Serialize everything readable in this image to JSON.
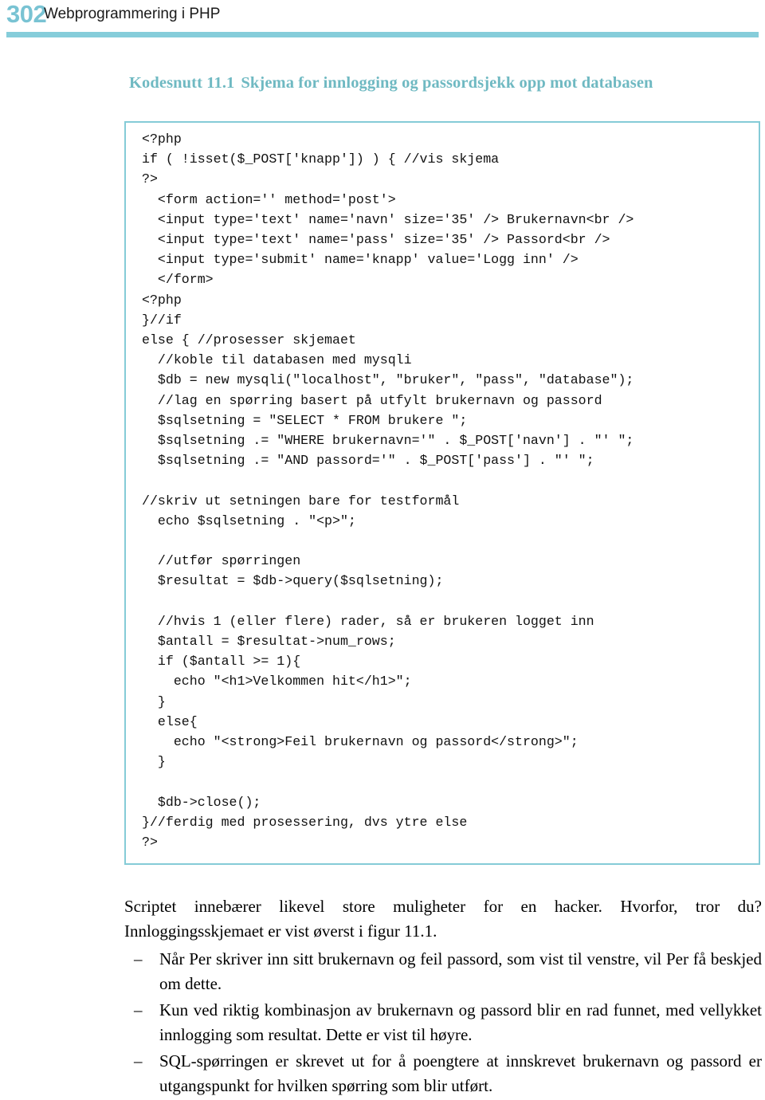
{
  "header": {
    "page_number": "302",
    "title": "Webprogrammering i PHP",
    "rule_color": "#86cdda",
    "page_number_color": "#79c3d3"
  },
  "snippet": {
    "label": "Kodesnutt 11.1",
    "title": "Skjema for innlogging og passordsjekk opp mot databasen",
    "caption_color": "#6fb9c2",
    "box_border_color": "#85cbd7",
    "code": "<?php\nif ( !isset($_POST['knapp']) ) { //vis skjema\n?>\n  <form action='' method='post'>\n  <input type='text' name='navn' size='35' /> Brukernavn<br />\n  <input type='text' name='pass' size='35' /> Passord<br />\n  <input type='submit' name='knapp' value='Logg inn' />\n  </form>\n<?php\n}//if\nelse { //prosesser skjemaet\n  //koble til databasen med mysqli\n  $db = new mysqli(\"localhost\", \"bruker\", \"pass\", \"database\");\n  //lag en spørring basert på utfylt brukernavn og passord\n  $sqlsetning = \"SELECT * FROM brukere \";\n  $sqlsetning .= \"WHERE brukernavn='\" . $_POST['navn'] . \"' \";\n  $sqlsetning .= \"AND passord='\" . $_POST['pass'] . \"' \";\n\n//skriv ut setningen bare for testformål\n  echo $sqlsetning . \"<p>\";\n\n  //utfør spørringen\n  $resultat = $db->query($sqlsetning);\n\n  //hvis 1 (eller flere) rader, så er brukeren logget inn\n  $antall = $resultat->num_rows;\n  if ($antall >= 1){\n    echo \"<h1>Velkommen hit</h1>\";\n  }\n  else{\n    echo \"<strong>Feil brukernavn og passord</strong>\";\n  }\n\n  $db->close();\n}//ferdig med prosessering, dvs ytre else\n?>"
  },
  "body": {
    "intro_paragraph": "Scriptet innebærer likevel store muligheter for en hacker. Hvorfor, tror du? Innloggingsskjemaet er vist øverst i figur 11.1.",
    "bullet_marker": "–",
    "bullets": [
      "Når Per skriver inn sitt brukernavn og feil passord, som vist til venstre, vil Per få beskjed om dette.",
      "Kun ved riktig kombinasjon av brukernavn og passord blir en rad funnet, med vellykket innlogging som resultat. Dette er vist til høyre.",
      "SQL-spørringen er skrevet ut for å poengtere at innskrevet brukernavn og passord er utgangspunkt for hvilken spørring som blir utført."
    ]
  }
}
